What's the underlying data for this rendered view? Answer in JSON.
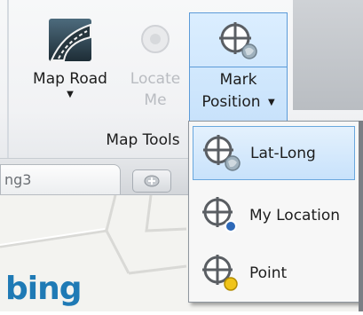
{
  "ribbon": {
    "map_road": {
      "label_line1": "Map Road",
      "icon": "road-icon"
    },
    "locate_me": {
      "label_line1": "Locate",
      "label_line2": "Me",
      "icon": "locate-me-icon",
      "enabled": false
    },
    "mark_position": {
      "label_line1": "Mark",
      "label_line2": "Position",
      "icon": "crosshair-globe-icon"
    },
    "group_label": "Map Tools"
  },
  "tabs": {
    "partial_tab_label": "ng3",
    "new_tab_icon": "plus-icon"
  },
  "map": {
    "logo": "bing"
  },
  "dropdown": {
    "items": [
      {
        "label": "Lat-Long",
        "icon": "crosshair-globe-icon",
        "highlighted": true
      },
      {
        "label": "My Location",
        "icon": "crosshair-blue-dot-icon",
        "highlighted": false
      },
      {
        "label": "Point",
        "icon": "crosshair-yellow-dot-icon",
        "highlighted": false
      }
    ]
  },
  "colors": {
    "highlight_border": "#5c9bd8",
    "highlight_fill": "#c8e2fb",
    "bing_blue": "#1f7ab5"
  }
}
